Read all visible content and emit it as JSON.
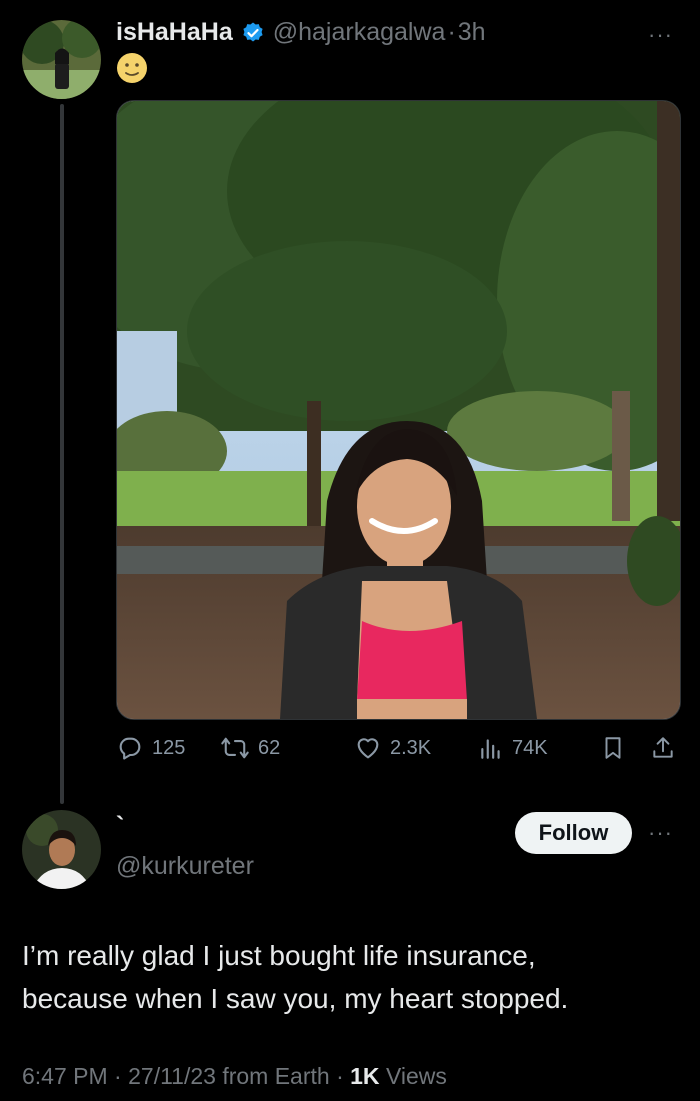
{
  "tweet": {
    "display_name": "isHaHaHa",
    "handle": "@hajarkagalwa",
    "separator": "·",
    "time": "3h",
    "body_emoji": "🙂",
    "more": "···"
  },
  "stats": {
    "replies": "125",
    "retweets": "62",
    "likes": "2.3K",
    "views": "74K"
  },
  "reply": {
    "display_name": "`",
    "handle": "@kurkureter",
    "follow_label": "Follow",
    "more": "···",
    "text_line1": "I’m really glad I just bought life insurance,",
    "text_line2": "because when I saw you, my heart stopped.",
    "meta_time": "6:47 PM",
    "meta_sep1": "·",
    "meta_date": "27/11/23 from Earth",
    "meta_sep2": "·",
    "meta_views_count": "1K",
    "meta_views_label": "Views"
  },
  "colors": {
    "background": "#000000",
    "text": "#e7e9ea",
    "muted": "#71767b",
    "verified": "#1d9bf0",
    "follow_bg": "#eff3f4"
  }
}
